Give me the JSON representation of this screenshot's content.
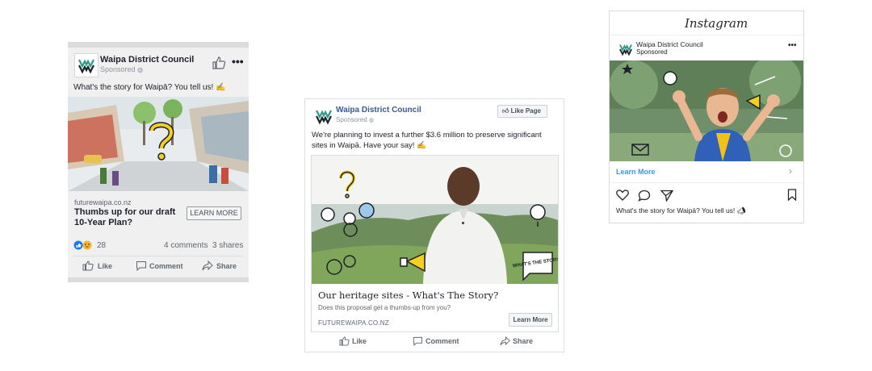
{
  "ad1": {
    "page_name": "Waipa District Council",
    "sponsored": "Sponsored",
    "body_text": "What's the story for Waipā? You tell us!",
    "link_domain": "futurewaipa.co.nz",
    "link_title": "Thumbs up for our draft 10-Year Plan?",
    "cta": "LEARN MORE",
    "reactions_count": "28",
    "comments": "4 comments",
    "shares": "3 shares",
    "actions": {
      "like": "Like",
      "comment": "Comment",
      "share": "Share"
    }
  },
  "ad2": {
    "page_name": "Waipa District Council",
    "sponsored": "Sponsored",
    "like_page": "Like Page",
    "body_text": "We're planning to invest a further $3.6 million to preserve significant sites in Waipā. Have your say!",
    "link_title": "Our heritage sites - What's The Story?",
    "link_description": "Does this proposal get a thumbs-up from you?",
    "link_domain": "FUTUREWAIPA.CO.NZ",
    "cta": "Learn More",
    "overlay_badge": "WHAT'S THE STORY?",
    "actions": {
      "like": "Like",
      "comment": "Comment",
      "share": "Share"
    }
  },
  "ad3": {
    "brand": "Instagram",
    "page_name": "Waipa District Council",
    "sponsored": "Sponsored",
    "cta": "Learn More",
    "caption": "What's the story for Waipā? You tell us!"
  },
  "colors": {
    "facebook_blue": "#385898",
    "instagram_link": "#3897f0",
    "logo_green": "#2a9a8a",
    "text": "#1d2129",
    "muted": "#606770"
  }
}
